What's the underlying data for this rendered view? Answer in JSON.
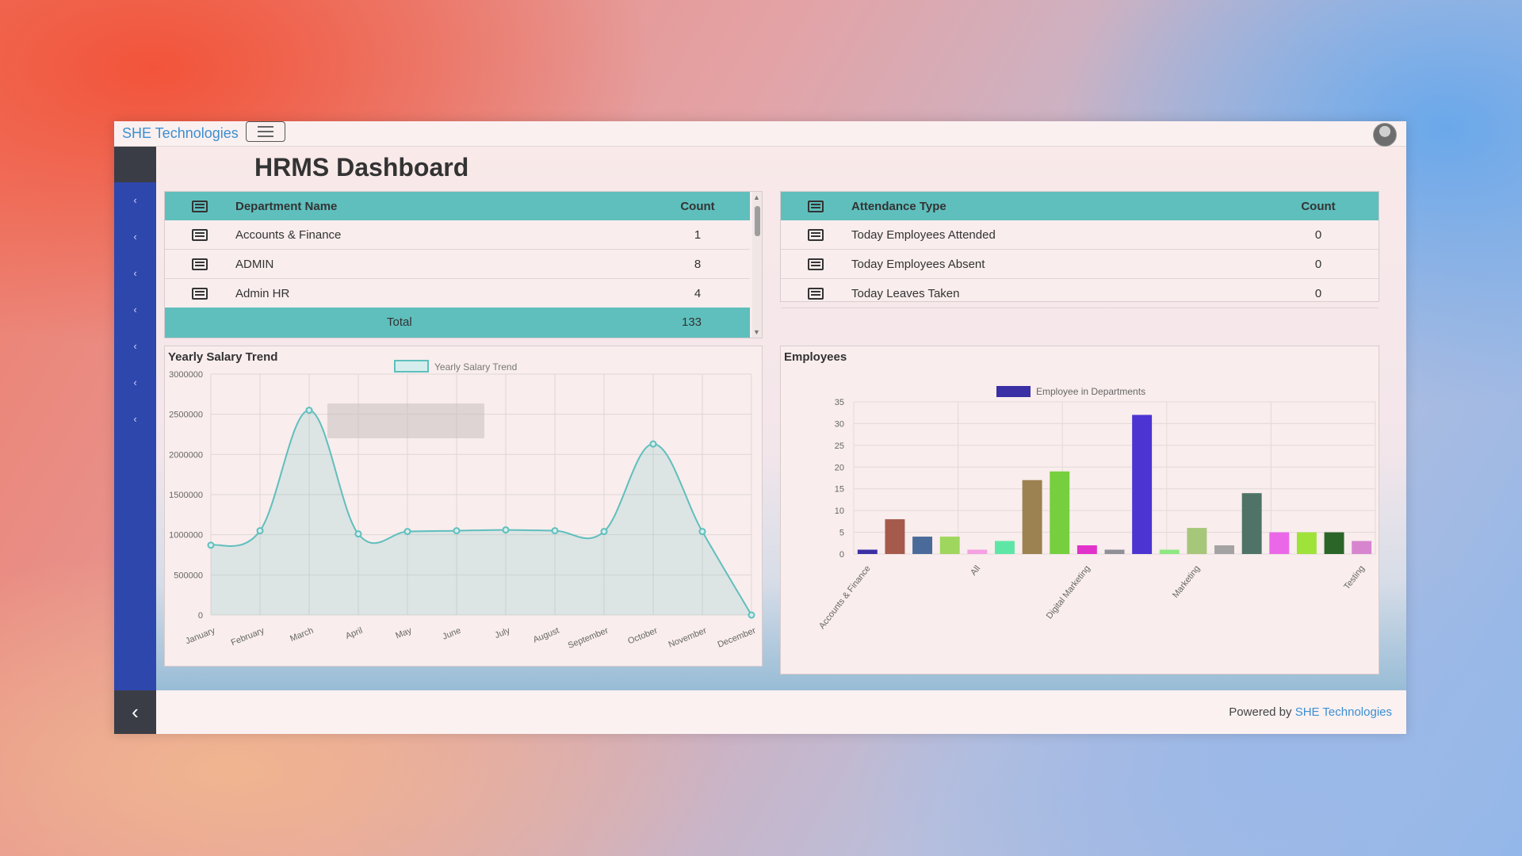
{
  "app": {
    "brand": "SHE Technologies",
    "page_title": "HRMS Dashboard"
  },
  "sidebar": {
    "item_count": 7,
    "collapse_icon": "chevron-left-icon"
  },
  "department_table": {
    "headers": {
      "name": "Department Name",
      "count": "Count"
    },
    "rows": [
      {
        "name": "Accounts & Finance",
        "count": "1"
      },
      {
        "name": "ADMIN",
        "count": "8"
      },
      {
        "name": "Admin HR",
        "count": "4"
      }
    ],
    "total_label": "Total",
    "total_value": "133"
  },
  "attendance_table": {
    "headers": {
      "type": "Attendance Type",
      "count": "Count"
    },
    "rows": [
      {
        "type": "Today Employees Attended",
        "count": "0"
      },
      {
        "type": "Today Employees Absent",
        "count": "0"
      },
      {
        "type": "Today Leaves Taken",
        "count": "0"
      }
    ]
  },
  "salary_chart": {
    "title": "Yearly Salary Trend",
    "legend": "Yearly Salary Trend",
    "color": "#5fbfbd"
  },
  "employees_chart": {
    "title": "Employees",
    "legend": "Employee in Departments",
    "legend_color": "#3b2fa5"
  },
  "footer": {
    "prefix": "Powered by",
    "link": "SHE Technologies"
  },
  "chart_data": [
    {
      "type": "area",
      "title": "Yearly Salary Trend",
      "series": [
        {
          "name": "Yearly Salary Trend",
          "values": [
            870000,
            1050000,
            2550000,
            1010000,
            1040000,
            1050000,
            1060000,
            1050000,
            1040000,
            2130000,
            1040000,
            0
          ]
        }
      ],
      "categories": [
        "January",
        "February",
        "March",
        "April",
        "May",
        "June",
        "July",
        "August",
        "September",
        "October",
        "November",
        "December"
      ],
      "ylim": [
        0,
        3000000
      ],
      "yticks": [
        "0",
        "500000",
        "1000000",
        "1500000",
        "2000000",
        "2500000",
        "3000000"
      ],
      "grid": true,
      "legend_position": "top"
    },
    {
      "type": "bar",
      "title": "Employees",
      "series": [
        {
          "name": "Employee in Departments",
          "values": [
            1,
            8,
            4,
            4,
            1,
            3,
            17,
            19,
            2,
            1,
            32,
            1,
            6,
            2,
            14,
            5,
            5,
            5,
            3
          ]
        }
      ],
      "colors": [
        "#3b2fa5",
        "#a55a4b",
        "#4a6b9a",
        "#9fd65d",
        "#f5a0e2",
        "#5ee6a6",
        "#9c8151",
        "#76cf3e",
        "#e133c9",
        "#8f8f98",
        "#4b34d2",
        "#8ee882",
        "#a6c67a",
        "#a3a3a3",
        "#4f7467",
        "#ea68e8",
        "#9fe23a",
        "#2b6528",
        "#d785cf"
      ],
      "category_labels": [
        "Accounts & Finance",
        "All",
        "Digital Marketing",
        "Marketing",
        "Testing"
      ],
      "label_positions": [
        0,
        4,
        8,
        12,
        18
      ],
      "ylim": [
        0,
        35
      ],
      "yticks": [
        "0",
        "5",
        "10",
        "15",
        "20",
        "25",
        "30",
        "35"
      ],
      "grid": true,
      "legend_position": "top"
    }
  ]
}
